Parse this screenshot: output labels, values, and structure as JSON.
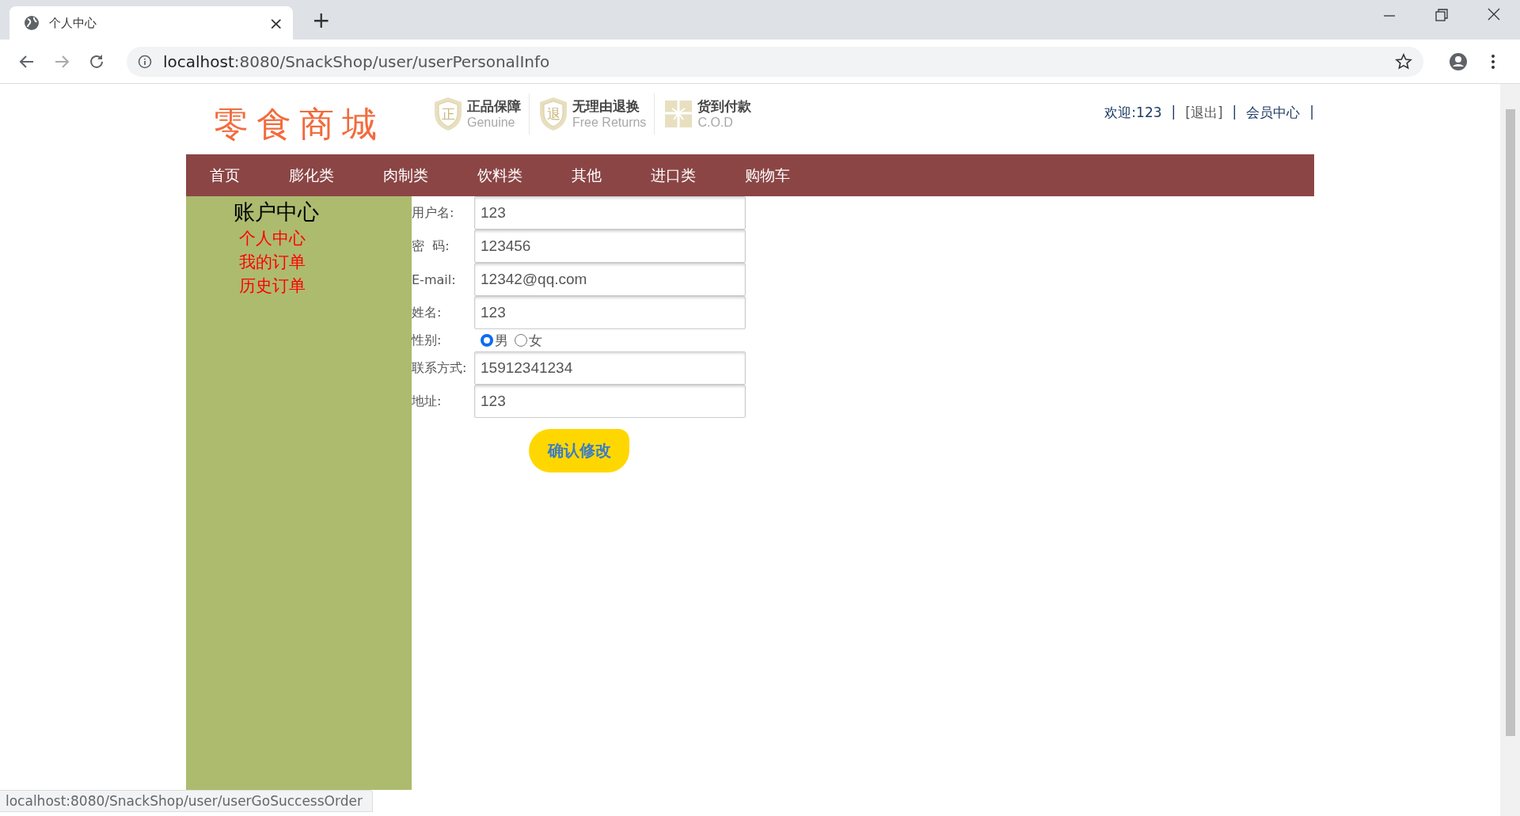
{
  "browser": {
    "tab": {
      "title": "个人中心",
      "close": "×"
    },
    "new_tab": "+",
    "address": {
      "host": "localhost",
      "rest": ":8080/SnackShop/user/userPersonalInfo"
    }
  },
  "header": {
    "logo": "零食商城",
    "badges": [
      {
        "kind": "shield",
        "mark": "正",
        "title": "正品保障",
        "subtitle": "Genuine"
      },
      {
        "kind": "shield",
        "mark": "退",
        "title": "无理由退换",
        "subtitle": "Free Returns"
      },
      {
        "kind": "gift",
        "title": "货到付款",
        "subtitle": "C.O.D"
      }
    ],
    "user_links": [
      {
        "kind": "text",
        "text": "欢迎:123"
      },
      {
        "kind": "separator",
        "text": "|"
      },
      {
        "kind": "link",
        "text": "[退出]"
      },
      {
        "kind": "separator",
        "text": "|"
      },
      {
        "kind": "link",
        "text": "会员中心"
      },
      {
        "kind": "separator",
        "text": "|"
      }
    ]
  },
  "nav": [
    "首页",
    "膨化类",
    "肉制类",
    "饮料类",
    "其他",
    "进口类",
    "购物车"
  ],
  "sidebar": {
    "title": "账户中心",
    "items": [
      "个人中心",
      "我的订单",
      "历史订单"
    ]
  },
  "form": {
    "fields": [
      {
        "kind": "text",
        "label": "用户名:",
        "value": "123"
      },
      {
        "kind": "text",
        "label": "密  码:",
        "value": "123456"
      },
      {
        "kind": "text",
        "label": "E-mail:",
        "value": "12342@qq.com"
      },
      {
        "kind": "text",
        "label": "姓名:",
        "value": "123"
      },
      {
        "kind": "radio",
        "label": "性别:",
        "options": [
          {
            "label": "男",
            "selected": true
          },
          {
            "label": "女",
            "selected": false
          }
        ]
      },
      {
        "kind": "text",
        "label": "联系方式:",
        "value": "15912341234"
      },
      {
        "kind": "text",
        "label": "地址:",
        "value": "123"
      }
    ],
    "submit": "确认修改"
  },
  "status_bar": "localhost:8080/SnackShop/user/userGoSuccessOrder"
}
